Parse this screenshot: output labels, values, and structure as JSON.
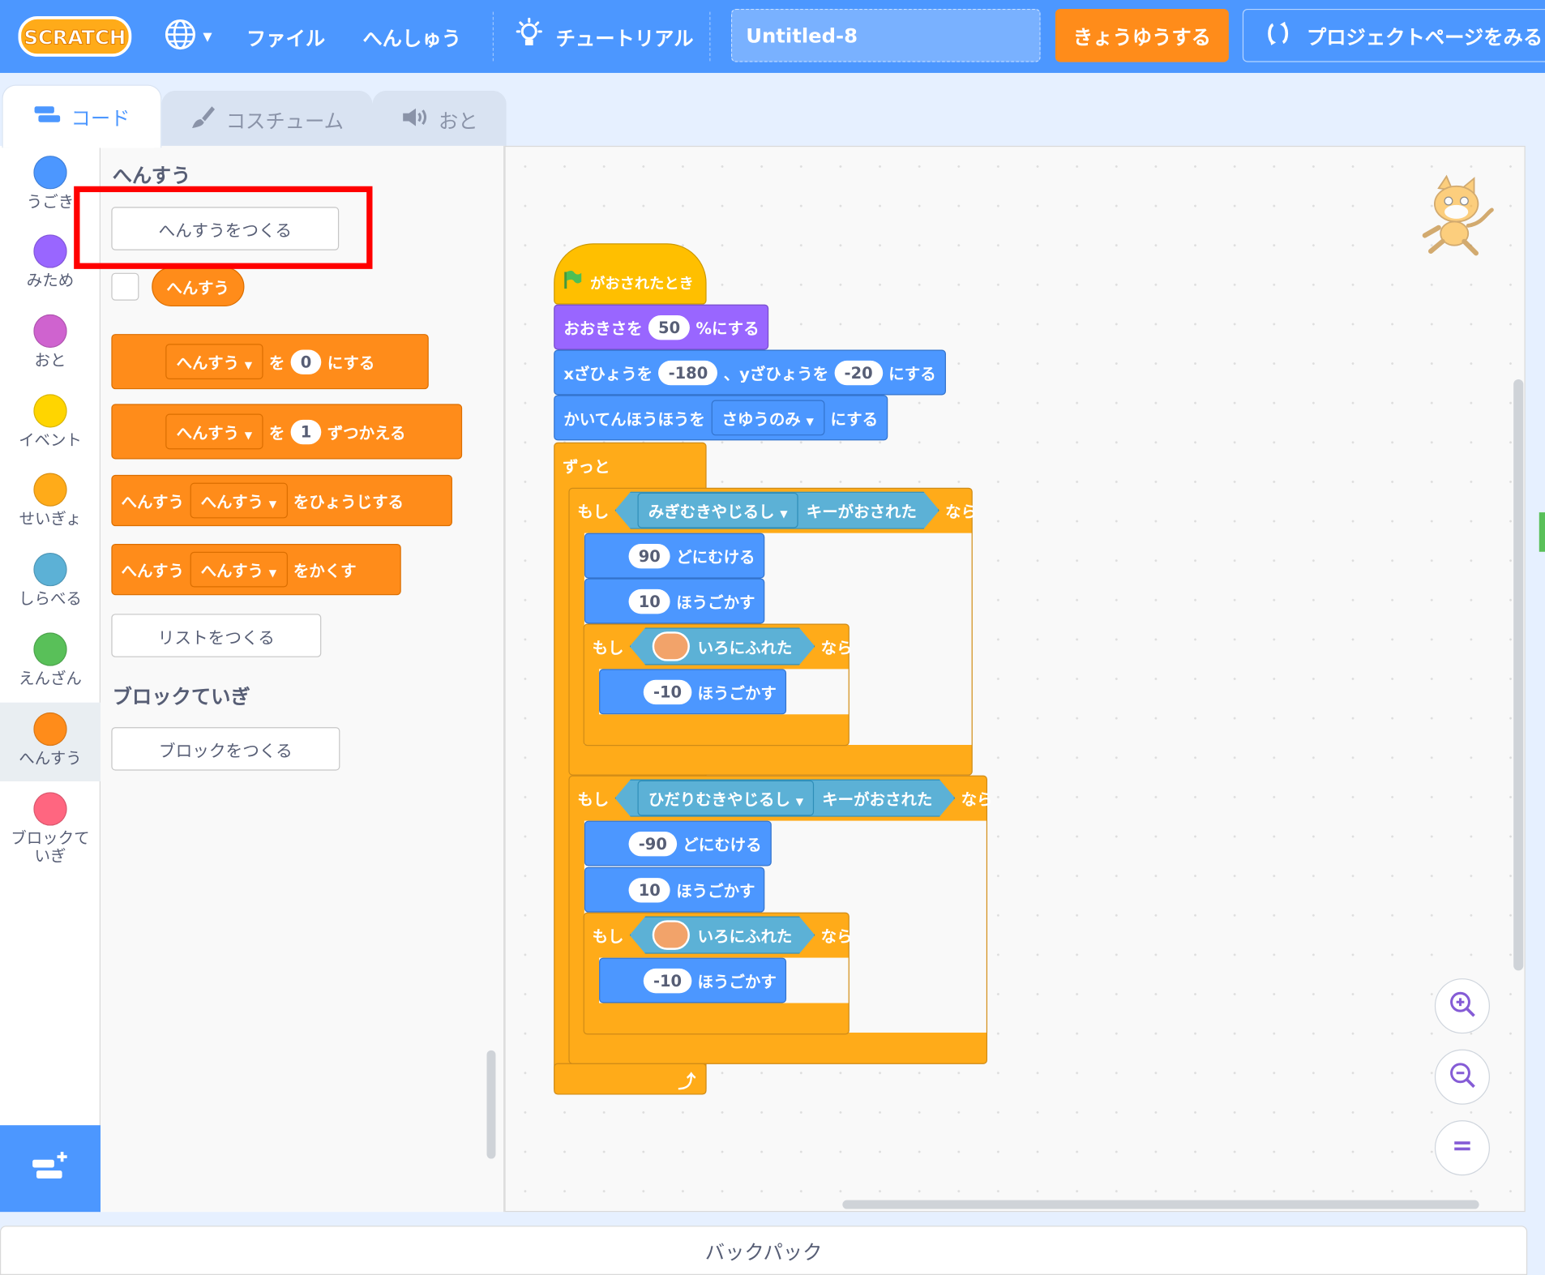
{
  "app": {
    "logo": "SCRATCH"
  },
  "menu": {
    "globe_icon": "globe-icon",
    "file": "ファイル",
    "edit": "へんしゅう",
    "tutorials": "チュートリアル",
    "project_title": "Untitled-8",
    "share": "きょうゆうする",
    "see_project_page": "プロジェクトページをみる"
  },
  "tabs": {
    "code": "コード",
    "costumes": "コスチューム",
    "sounds": "おと"
  },
  "categories": [
    {
      "label": "うごき",
      "color": "#4c97ff"
    },
    {
      "label": "みため",
      "color": "#9966ff"
    },
    {
      "label": "おと",
      "color": "#cf63cf"
    },
    {
      "label": "イベント",
      "color": "#ffd500"
    },
    {
      "label": "せいぎょ",
      "color": "#ffab19"
    },
    {
      "label": "しらべる",
      "color": "#5cb1d6"
    },
    {
      "label": "えんざん",
      "color": "#59c059"
    },
    {
      "label": "へんすう",
      "color": "#ff8c1a"
    },
    {
      "label1": "ブロックて",
      "label2": "いぎ",
      "color": "#ff6680"
    }
  ],
  "palette": {
    "section_title": "へんすう",
    "make_variable": "へんすうをつくる",
    "var_reporter": "へんすう",
    "set_block": {
      "dropdown": "へんすう",
      "to": "を",
      "value": "0",
      "suffix": "にする"
    },
    "change_block": {
      "dropdown": "へんすう",
      "by": "を",
      "value": "1",
      "suffix": "ずつかえる"
    },
    "show_block": {
      "prefix": "へんすう",
      "dropdown": "へんすう",
      "suffix": "をひょうじする"
    },
    "hide_block": {
      "prefix": "へんすう",
      "dropdown": "へんすう",
      "suffix": "をかくす"
    },
    "make_list": "リストをつくる",
    "my_blocks_title": "ブロックていぎ",
    "make_block": "ブロックをつくる"
  },
  "script": {
    "hat": "がおされたとき",
    "size": {
      "prefix": "おおきさを",
      "value": "50",
      "suffix": "%にする"
    },
    "goto": {
      "x_label": "xざひょうを",
      "x": "-180",
      "y_label": "、yざひょうを",
      "y": "-20",
      "suffix": "にする"
    },
    "rotation": {
      "prefix": "かいてんほうほうを",
      "dropdown": "さゆうのみ",
      "suffix": "にする"
    },
    "forever": "ずっと",
    "if": "もし",
    "then": "なら",
    "if1": {
      "key": "みぎむきやじるし",
      "pressed": "キーがおされた"
    },
    "point1": {
      "value": "90",
      "label": "どにむける"
    },
    "move1": {
      "value": "10",
      "label": "ほうごかす"
    },
    "touch": "いろにふれた",
    "touch_color": "#f2a36a",
    "move_back": {
      "value": "-10",
      "label": "ほうごかす"
    },
    "if2": {
      "key": "ひだりむきやじるし",
      "pressed": "キーがおされた"
    },
    "point2": {
      "value": "-90",
      "label": "どにむける"
    },
    "move2": {
      "value": "10",
      "label": "ほうごかす"
    }
  },
  "backpack": "バックパック"
}
